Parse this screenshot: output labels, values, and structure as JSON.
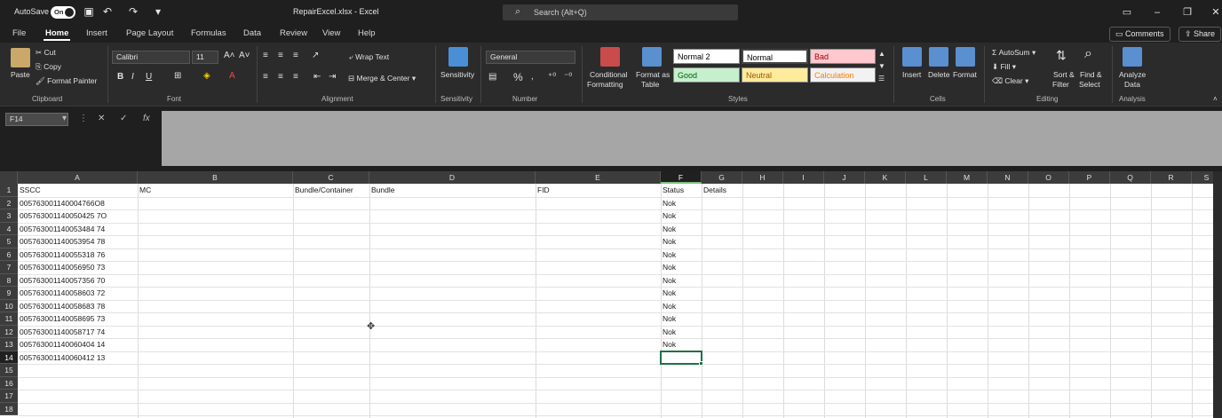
{
  "titlebar": {
    "autosave_label": "AutoSave",
    "autosave_state": "On",
    "title": "RepairExcel.xlsx  -  Excel",
    "search_placeholder": "Search (Alt+Q)"
  },
  "tabs": [
    "File",
    "Home",
    "Insert",
    "Page Layout",
    "Formulas",
    "Data",
    "Review",
    "View",
    "Help"
  ],
  "active_tab": "Home",
  "header_buttons": {
    "comments": "Comments",
    "share": "Share"
  },
  "ribbon": {
    "clipboard": {
      "paste": "Paste",
      "cut": "Cut",
      "copy": "Copy",
      "format_painter": "Format Painter",
      "label": "Clipboard"
    },
    "font": {
      "name": "Calibri",
      "size": "11",
      "label": "Font",
      "bold": "B",
      "italic": "I",
      "underline": "U"
    },
    "alignment": {
      "wrap": "Wrap Text",
      "merge": "Merge & Center",
      "label": "Alignment"
    },
    "sensitivity": {
      "button": "Sensitivity",
      "label": "Sensitivity"
    },
    "number": {
      "format": "General",
      "percent": "%",
      "label": "Number"
    },
    "styles": {
      "conditional": [
        "Conditional",
        "Formatting"
      ],
      "format_table": [
        "Format as",
        "Table"
      ],
      "cells": [
        "Normal 2",
        "Normal",
        "Bad",
        "Good",
        "Neutral",
        "Calculation"
      ],
      "label": "Styles"
    },
    "cells": {
      "insert": "Insert",
      "delete": "Delete",
      "format": "Format",
      "label": "Cells"
    },
    "editing": {
      "autosum": "AutoSum",
      "fill": "Fill",
      "clear": "Clear",
      "sort": [
        "Sort &",
        "Filter"
      ],
      "find": [
        "Find &",
        "Select"
      ],
      "label": "Editing"
    },
    "analysis": {
      "analyze": [
        "Analyze",
        "Data"
      ],
      "label": "Analysis"
    }
  },
  "formula_bar": {
    "name_box": "F14",
    "fx": "fx",
    "content": ""
  },
  "columns": [
    "A",
    "B",
    "C",
    "D",
    "E",
    "F",
    "G",
    "H",
    "I",
    "J",
    "K",
    "L",
    "M",
    "N",
    "O",
    "P",
    "Q",
    "R",
    "S"
  ],
  "selected_column": "F",
  "rows": [
    "1",
    "2",
    "3",
    "4",
    "5",
    "6",
    "7",
    "8",
    "9",
    "10",
    "11",
    "12",
    "13",
    "14",
    "15",
    "16",
    "17",
    "18"
  ],
  "selected_row": "14",
  "sheet": {
    "headers": {
      "A": "SSCC",
      "B": "MC",
      "C": "Bundle/Container",
      "D": "Bundle",
      "E": "FID",
      "F": "Status",
      "G": "Details"
    },
    "sscc": [
      "005763001140004766O8",
      "005763001140050425 7O",
      "005763001140053484 74",
      "005763001140053954 78",
      "005763001140055318 76",
      "005763001140056950 73",
      "005763001140057356 70",
      "005763001140058603 72",
      "005763001140058683 78",
      "005763001140058695 73",
      "005763001140058717 74",
      "005763001140060404 14",
      "005763001140060412 13"
    ],
    "status": [
      "Nok",
      "Nok",
      "Nok",
      "Nok",
      "Nok",
      "Nok",
      "Nok",
      "Nok",
      "Nok",
      "Nok",
      "Nok",
      "Nok"
    ]
  }
}
